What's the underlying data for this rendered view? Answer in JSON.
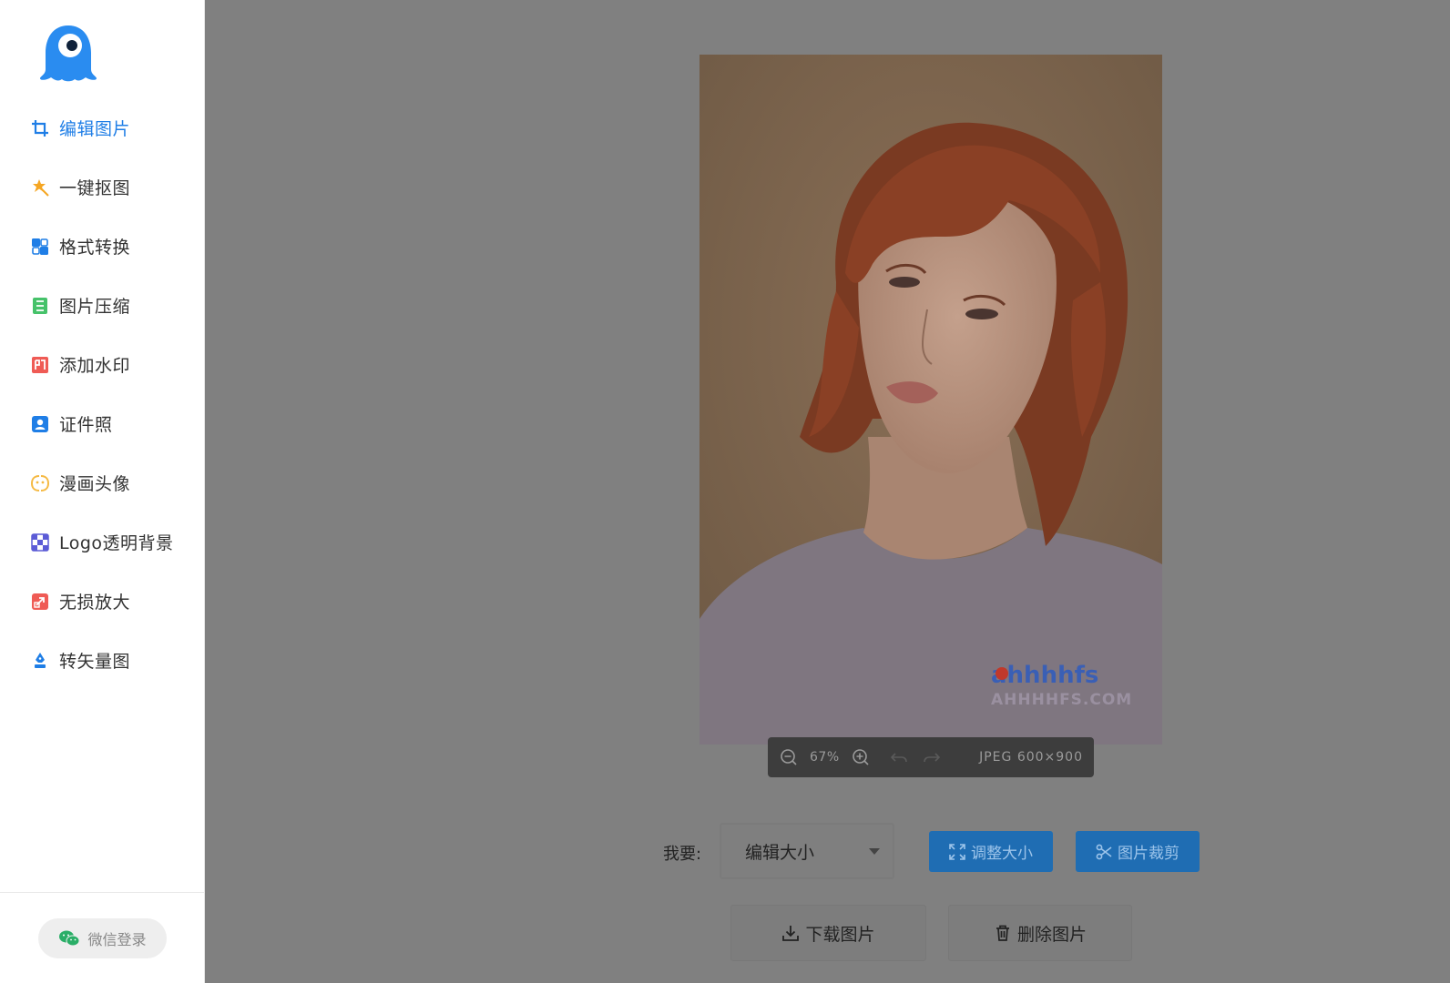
{
  "sidebar": {
    "items": [
      {
        "label": "编辑图片",
        "icon": "crop-icon",
        "active": true
      },
      {
        "label": "一键抠图",
        "icon": "magic-wand-icon"
      },
      {
        "label": "格式转换",
        "icon": "format-convert-icon"
      },
      {
        "label": "图片压缩",
        "icon": "compress-icon"
      },
      {
        "label": "添加水印",
        "icon": "watermark-icon"
      },
      {
        "label": "证件照",
        "icon": "id-photo-icon"
      },
      {
        "label": "漫画头像",
        "icon": "cartoon-avatar-icon"
      },
      {
        "label": "Logo透明背景",
        "icon": "transparent-bg-icon"
      },
      {
        "label": "无损放大",
        "icon": "upscale-icon"
      },
      {
        "label": "转矢量图",
        "icon": "vector-icon"
      }
    ],
    "wechat_login": "微信登录"
  },
  "image_toolbar": {
    "zoom": "67%",
    "format_info": "JPEG 600×900"
  },
  "photo": {
    "watermark_brand": "ahhhhfs",
    "watermark_site": "AHHHHFS.COM"
  },
  "controls": {
    "want_label": "我要:",
    "mode_select": "编辑大小",
    "resize_button": "调整大小",
    "crop_button": "图片裁剪",
    "download_button": "下载图片",
    "delete_button": "删除图片"
  },
  "colors": {
    "accent": "#1f7ee6",
    "overlay": "#808080"
  }
}
